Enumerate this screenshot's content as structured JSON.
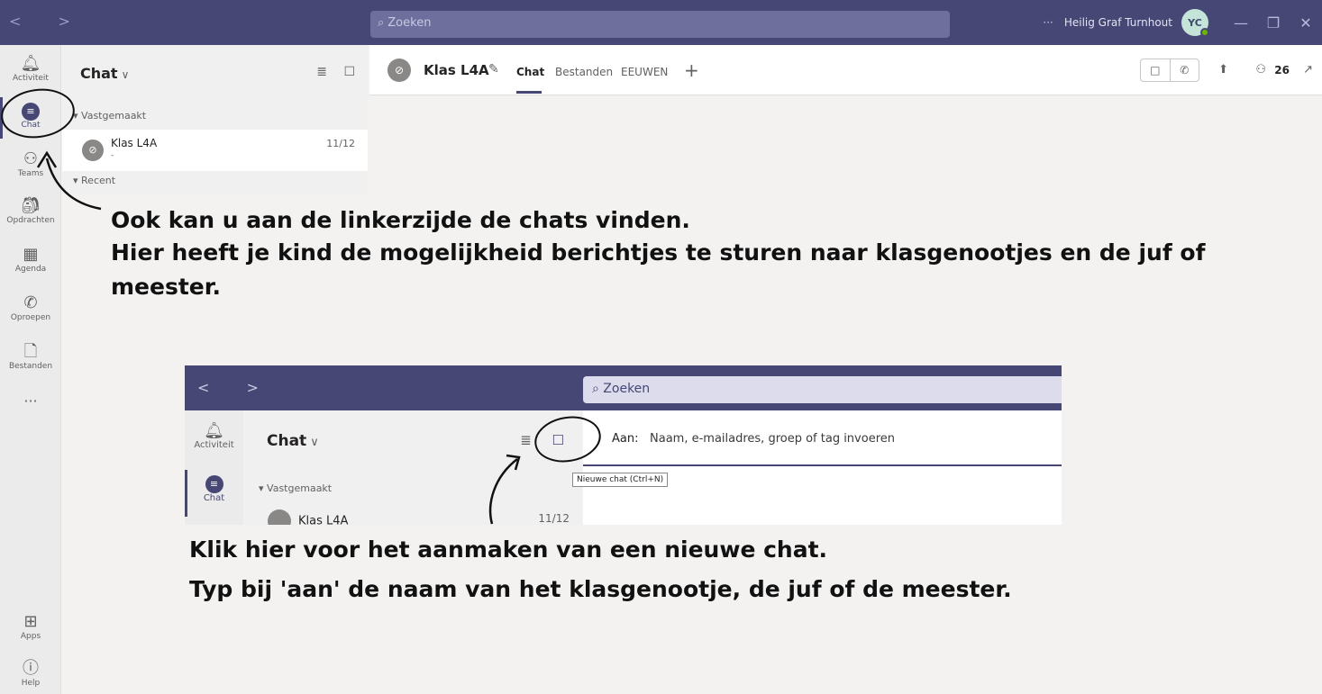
{
  "topbar": {
    "nav_arrows": "<  >",
    "search_placeholder": "Zoeken",
    "more": "···",
    "org_name": "Heilig Graf Turnhout",
    "avatar_initials": "YC",
    "minimize": "—",
    "maximize": "❐",
    "close": "✕"
  },
  "rail": {
    "items": [
      {
        "label": "Activiteit",
        "icon": "bell-icon"
      },
      {
        "label": "Chat",
        "icon": "chat-icon"
      },
      {
        "label": "Teams",
        "icon": "teams-icon"
      },
      {
        "label": "Opdrachten",
        "icon": "assignments-icon"
      },
      {
        "label": "Agenda",
        "icon": "calendar-icon"
      },
      {
        "label": "Oproepen",
        "icon": "phone-icon"
      },
      {
        "label": "Bestanden",
        "icon": "file-icon"
      }
    ],
    "more": "···",
    "apps_label": "Apps",
    "help_label": "Help"
  },
  "chatlist": {
    "title": "Chat",
    "pinned_label": "Vastgemaakt",
    "recent_label": "Recent",
    "chats": [
      {
        "name": "Klas L4A",
        "preview": "-",
        "date": "11/12"
      }
    ]
  },
  "conversation": {
    "title": "Klas L4A",
    "tabs": [
      "Chat",
      "Bestanden",
      "EEUWEN"
    ],
    "participant_count": "26"
  },
  "annotations": {
    "top_line1": "Ook kan u aan de linkerzijde de chats vinden.",
    "top_line2": "Hier heeft je kind de mogelijkheid berichtjes te sturen naar klasgenootjes en de juf of",
    "top_line3": "meester.",
    "bottom_line1": "Klik hier voor het aanmaken van een nieuwe chat.",
    "bottom_line2": "Typ bij 'aan' de naam van het klasgenootje, de juf of de meester."
  },
  "inset": {
    "search_placeholder": "Zoeken",
    "rail_activity": "Activiteit",
    "rail_chat": "Chat",
    "chat_title": "Chat",
    "pinned_label": "Vastgemaakt",
    "chat_name": "Klas L4A",
    "chat_date": "11/12",
    "to_label": "Aan:",
    "to_placeholder": "Naam, e-mailadres, groep of tag invoeren",
    "tooltip": "Nieuwe chat (Ctrl+N)"
  },
  "colors": {
    "brand": "#464775",
    "annotation": "#111111"
  }
}
